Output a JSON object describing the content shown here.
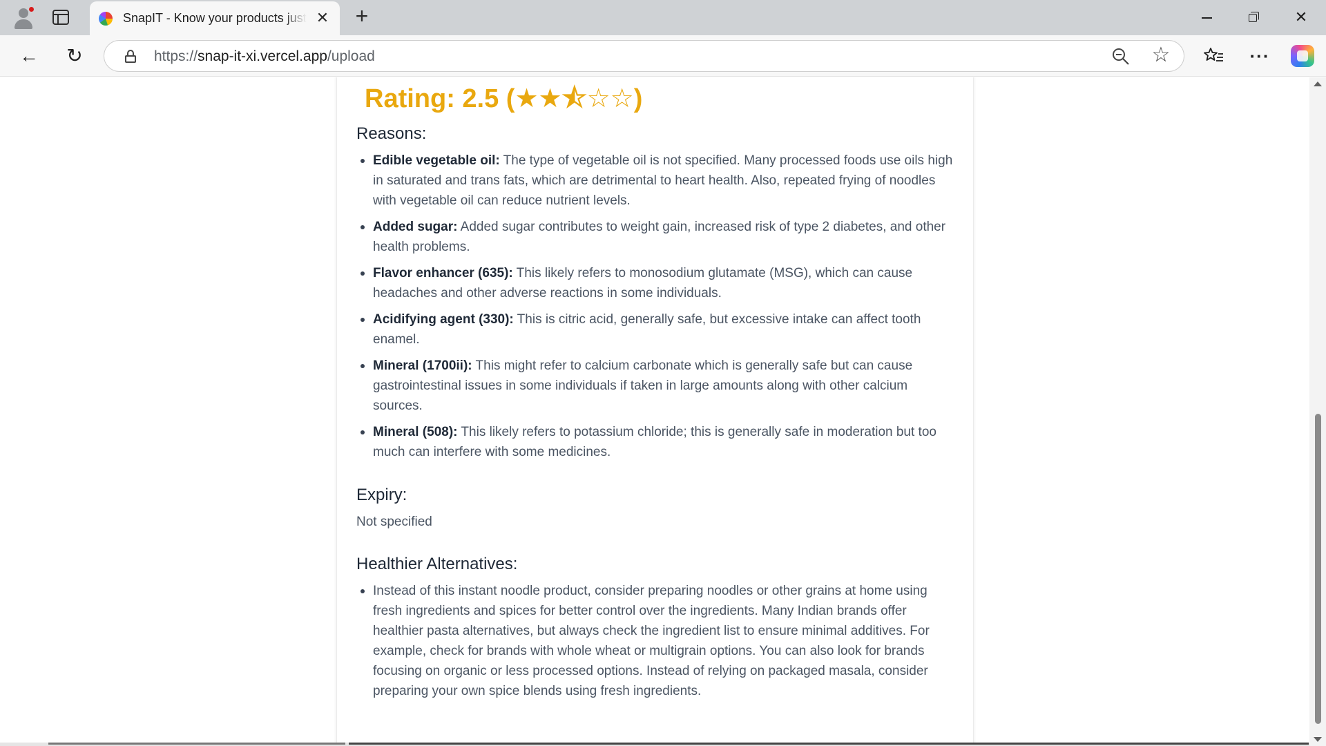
{
  "browser": {
    "tab_title": "SnapIT - Know your products just",
    "tab_close_glyph": "✕",
    "new_tab_glyph": "+",
    "url_scheme": "https://",
    "url_host": "snap-it-xi.vercel.app",
    "url_path": "/upload",
    "icons": {
      "profile": "profile-avatar-icon",
      "tab_actions": "tab-actions-icon",
      "back": "back-arrow-icon",
      "refresh": "refresh-icon",
      "lock": "lock-icon",
      "zoom": "zoom-out-icon",
      "favorite": "star-icon",
      "favorites": "favorites-list-icon",
      "more": "more-menu-icon",
      "copilot": "copilot-icon",
      "minimize": "minimize-icon",
      "restore": "restore-icon",
      "close": "window-close-icon"
    },
    "glyphs": {
      "back": "←",
      "refresh": "↻",
      "star": "☆",
      "more": "···",
      "close": "✕"
    }
  },
  "result": {
    "rating_text": "Rating: 2.5 (★★⯪☆☆)",
    "rating_color": "#e9a80f",
    "reasons_heading": "Reasons:",
    "reasons": [
      {
        "term": "Edible vegetable oil:",
        "text": " The type of vegetable oil is not specified. Many processed foods use oils high in saturated and trans fats, which are detrimental to heart health. Also, repeated frying of noodles with vegetable oil can reduce nutrient levels."
      },
      {
        "term": "Added sugar:",
        "text": " Added sugar contributes to weight gain, increased risk of type 2 diabetes, and other health problems."
      },
      {
        "term": "Flavor enhancer (635):",
        "text": " This likely refers to monosodium glutamate (MSG), which can cause headaches and other adverse reactions in some individuals."
      },
      {
        "term": "Acidifying agent (330):",
        "text": " This is citric acid, generally safe, but excessive intake can affect tooth enamel."
      },
      {
        "term": "Mineral (1700ii):",
        "text": " This might refer to calcium carbonate which is generally safe but can cause gastrointestinal issues in some individuals if taken in large amounts along with other calcium sources."
      },
      {
        "term": "Mineral (508):",
        "text": " This likely refers to potassium chloride; this is generally safe in moderation but too much can interfere with some medicines."
      }
    ],
    "expiry_heading": "Expiry:",
    "expiry_value": "Not specified",
    "alternatives_heading": "Healthier Alternatives:",
    "alternatives": [
      "Instead of this instant noodle product, consider preparing noodles or other grains at home using fresh ingredients and spices for better control over the ingredients. Many Indian brands offer healthier pasta alternatives, but always check the ingredient list to ensure minimal additives. For example, check for brands with whole wheat or multigrain options. You can also look for brands focusing on organic or less processed options. Instead of relying on packaged masala, consider preparing your own spice blends using fresh ingredients."
    ]
  }
}
